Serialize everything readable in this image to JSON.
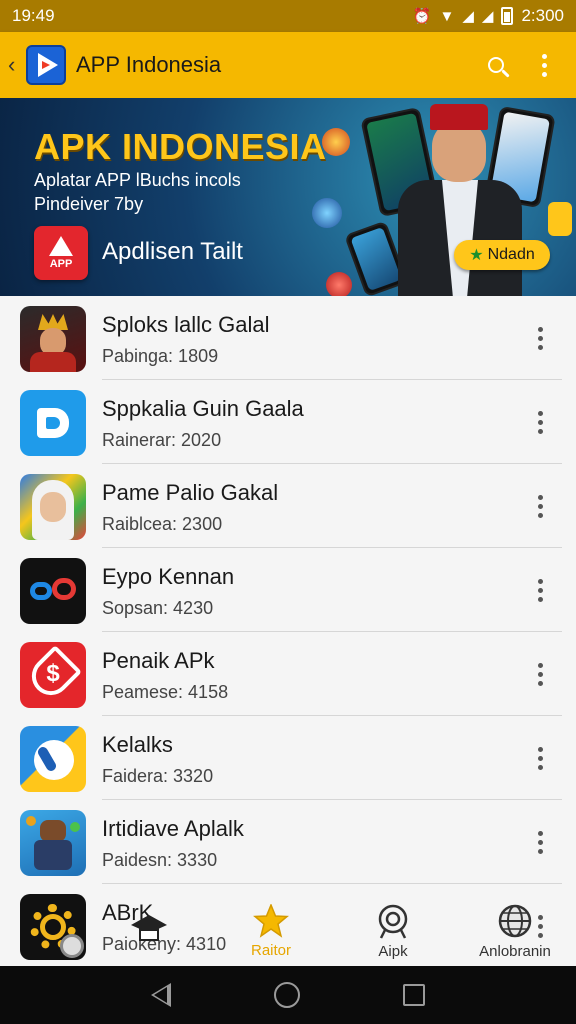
{
  "status_bar": {
    "time": "19:49",
    "battery_text": "2:300"
  },
  "app_bar": {
    "back_glyph": "‹",
    "title": "APP Indonesia"
  },
  "banner": {
    "title": "APK INDONESIA",
    "subtitle_line1": "Aplatar APP lBuchs incols",
    "subtitle_line2": "Pindeiver 7by",
    "app_icon_label": "APP",
    "app_name": "Apdlisen Tailt",
    "cta_label": "Ndadn"
  },
  "apps": [
    {
      "name": "Sploks lallc Galal",
      "meta": "Pabinga: 1809",
      "icon": "warrior-icon"
    },
    {
      "name": "Sppkalia Guin Gaala",
      "meta": "Rainerar: 2020",
      "icon": "blue-b-icon"
    },
    {
      "name": "Pame Palio Gakal",
      "meta": "Raiblcea: 2300",
      "icon": "portrait-icon"
    },
    {
      "name": "Eypo Kennan",
      "meta": "Sopsan: 4230",
      "icon": "link-icon"
    },
    {
      "name": "Penaik APk",
      "meta": "Peamese: 4158",
      "icon": "shield-dollar-icon"
    },
    {
      "name": "Kelalks",
      "meta": "Faidera: 3320",
      "icon": "phone-icon"
    },
    {
      "name": "Irtidiave Aplalk",
      "meta": "Paidesn: 3330",
      "icon": "robot-icon"
    },
    {
      "name": "ABrK",
      "meta": "Paiokeny: 4310",
      "icon": "gear-icon"
    }
  ],
  "bottom_nav": [
    {
      "label": "",
      "icon": "hat-icon"
    },
    {
      "label": "Raitor",
      "icon": "star-icon",
      "active": true
    },
    {
      "label": "Aipk",
      "icon": "award-icon"
    },
    {
      "label": "Anlobranin",
      "icon": "globe-icon"
    }
  ],
  "colors": {
    "accent": "#f5b800",
    "status_bar": "#a87b00",
    "active_tab": "#e6a600"
  }
}
